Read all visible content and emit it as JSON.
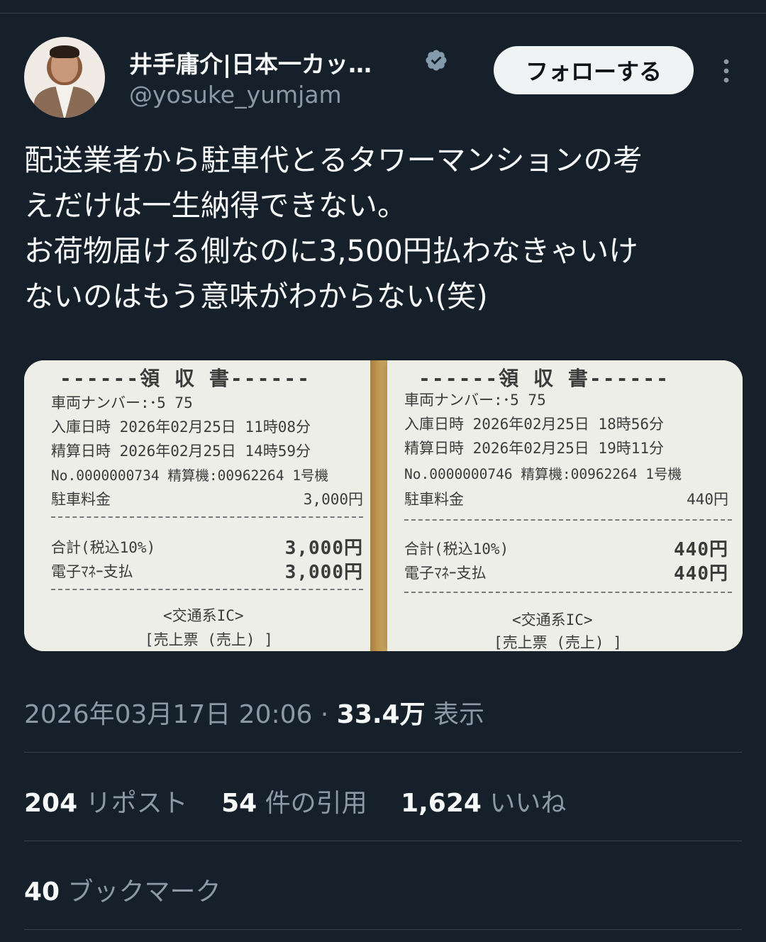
{
  "author": {
    "display_name": "井手庸介|日本一カッ…",
    "handle": "@yosuke_yumjam",
    "verified_icon": "verified-badge-icon",
    "follow_label": "フォローする",
    "more_icon": "more-vertical-icon"
  },
  "tweet": {
    "text": "配送業者から駐車代とるタワーマンションの考\nえだけは一生納得できない。\nお荷物届ける側なのに3,500円払わなきゃいけ\nないのはもう意味がわからない(笑)"
  },
  "media": {
    "receipts": [
      {
        "title": "------領  収  書------",
        "vehicle": "車両ナンバー:･5 75",
        "entry": "入庫日時  2026年02月25日  11時08分",
        "settle": "精算日時  2026年02月25日  14時59分",
        "machine": "No.0000000734 精算機:00962264 1号機",
        "fee_label": "駐車料金",
        "fee_value": "3,000円",
        "total_label": "合計(税込10%)",
        "total_value": "3,000円",
        "emoney_label": "電子ﾏﾈｰ支払",
        "emoney_value": "3,000円",
        "ic": "<交通系IC>",
        "sales": "[売上票 (売上) ]"
      },
      {
        "title": "------領  収  書------",
        "vehicle": "車両ナンバー:･5 75",
        "entry": "入庫日時  2026年02月25日  18時56分",
        "settle": "精算日時  2026年02月25日  19時11分",
        "machine": "No.0000000746 精算機:00962264 1号機",
        "fee_label": "駐車料金",
        "fee_value": "440円",
        "total_label": "合計(税込10%)",
        "total_value": "440円",
        "emoney_label": "電子ﾏﾈｰ支払",
        "emoney_value": "440円",
        "ic": "<交通系IC>",
        "sales": "[売上票 (売上) ]"
      }
    ]
  },
  "meta": {
    "timestamp": "2026年03月17日 20:06",
    "separator": " · ",
    "views_count": "33.4万",
    "views_label": " 表示"
  },
  "stats": {
    "reposts": {
      "count": "204",
      "label": " リポスト"
    },
    "quotes": {
      "count": "54",
      "label": " 件の引用"
    },
    "likes": {
      "count": "1,624",
      "label": " いいね"
    },
    "bookmarks": {
      "count": "40",
      "label": " ブックマーク"
    }
  },
  "colors": {
    "background": "#15202b",
    "text_primary": "#f7f9f9",
    "text_secondary": "#8b98a5",
    "verified": "#829aab",
    "divider": "#38444d"
  }
}
